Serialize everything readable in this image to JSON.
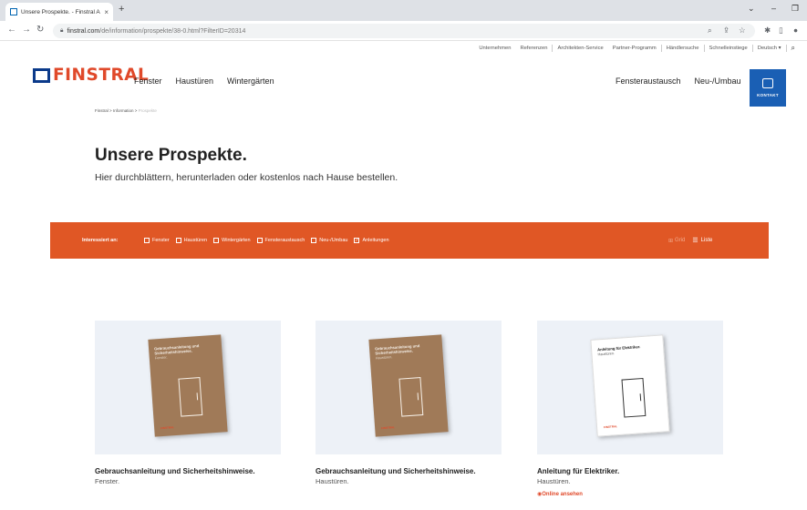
{
  "browser": {
    "tab_title": "Unsere Prospekte. - Finstral AG",
    "tab_close": "×",
    "new_tab": "+",
    "url_host": "finstral.com",
    "url_path": "/de/information/prospekte/38-0.html?FilterID=20314"
  },
  "utility_nav": {
    "items": [
      "Unternehmen",
      "Referenzen",
      "Architekten-Service",
      "Partner-Programm",
      "Händlersuche",
      "Schnelleinstiege",
      "Deutsch ▾"
    ]
  },
  "header": {
    "logo_text": "FINSTRAL",
    "main_nav": [
      "Fenster",
      "Haustüren",
      "Wintergärten"
    ],
    "right_nav": [
      "Fensteraustausch",
      "Neu-/Umbau"
    ],
    "kontakt_label": "KONTAKT"
  },
  "breadcrumb": {
    "items": [
      "Finstral",
      "Information"
    ],
    "separator": ">",
    "current": "Prospekte"
  },
  "hero": {
    "title": "Unsere Prospekte.",
    "subtitle": "Hier durchblättern, herunterladen oder kostenlos nach Hause bestellen."
  },
  "filter": {
    "label": "Interessiert an:",
    "options": [
      {
        "label": "Fenster",
        "checked": false
      },
      {
        "label": "Haustüren",
        "checked": false
      },
      {
        "label": "Wintergärten",
        "checked": false
      },
      {
        "label": "Fensteraustausch",
        "checked": false
      },
      {
        "label": "Neu-/Umbau",
        "checked": false
      },
      {
        "label": "Anleitungen",
        "checked": true
      }
    ],
    "view_grid": "Grid",
    "view_list": "Liste"
  },
  "cards": [
    {
      "title": "Gebrauchsanleitung und Sicherheitshinweise.",
      "subtitle": "Fenster.",
      "brochure_title": "Gebrauchsanleitung und Sicherheitshinweise.",
      "brochure_sub": "Fenster.",
      "brochure_logo": "FINSTRAL"
    },
    {
      "title": "Gebrauchsanleitung und Sicherheitshinweise.",
      "subtitle": "Haustüren.",
      "brochure_title": "Gebrauchsanleitung und Sicherheitshinweise.",
      "brochure_sub": "Haustüren.",
      "brochure_logo": "FINSTRAL"
    },
    {
      "title": "Anleitung für Elektriker.",
      "subtitle": "Haustüren.",
      "link": "Online ansehen",
      "brochure_title": "Anleitung für Elektriker.",
      "brochure_sub": "Haustüren.",
      "brochure_logo": "FINSTRAL"
    }
  ],
  "colors": {
    "brand_orange": "#e05725",
    "brand_blue": "#1a5fb4",
    "logo_blue": "#0b3a8a",
    "card_bg": "#edf1f7"
  }
}
